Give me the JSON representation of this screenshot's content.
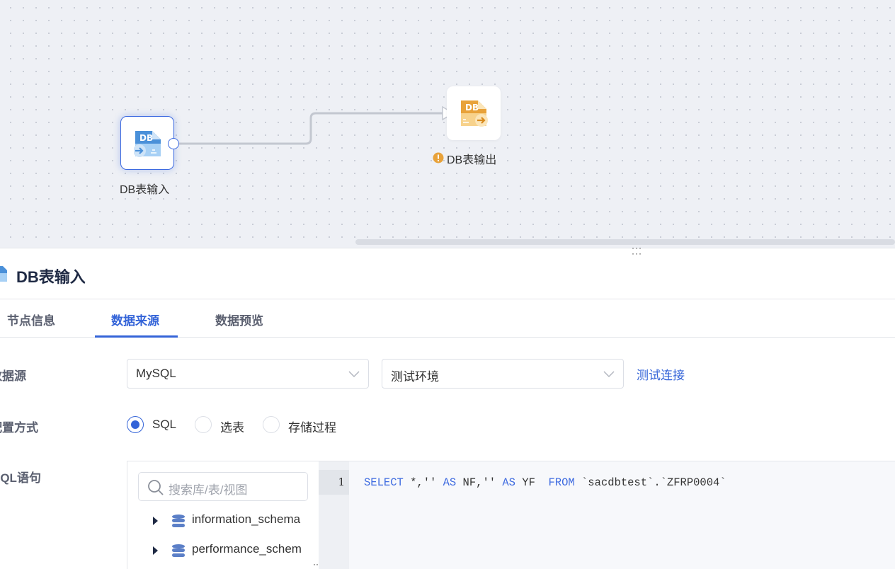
{
  "canvas": {
    "nodes": [
      {
        "label": "DB表输入",
        "icon": "db-input-icon",
        "selected": true
      },
      {
        "label": "DB表输出",
        "icon": "db-output-icon",
        "warning": true
      }
    ],
    "resize_handle": "⋮⋮"
  },
  "panel": {
    "title": "DB表输入",
    "tabs": [
      {
        "label": "节点信息"
      },
      {
        "label": "数据来源",
        "active": true
      },
      {
        "label": "数据预览"
      }
    ],
    "form": {
      "datasource_label": "数据源",
      "datasource_type": "MySQL",
      "datasource_env": "测试环境",
      "test_connection": "测试连接",
      "config_label": "配置方式",
      "config_options": [
        "SQL",
        "选表",
        "存储过程"
      ],
      "config_selected": "SQL",
      "sql_label": "SQL语句"
    },
    "tree": {
      "search_placeholder": "搜索库/表/视图",
      "items": [
        "information_schema",
        "performance_schema"
      ]
    },
    "editor": {
      "line_number": "1",
      "tokens": {
        "select": "SELECT",
        "t1": " *,'' ",
        "as1": "AS",
        "t2": " NF,'' ",
        "as2": "AS",
        "t3": " YF  ",
        "from": "FROM",
        "t4": " `sacdbtest`.`ZFRP0004`"
      }
    }
  },
  "colors": {
    "accent": "#3464d8",
    "warning": "#e8a23a",
    "canvas_bg": "#eef0f5"
  }
}
